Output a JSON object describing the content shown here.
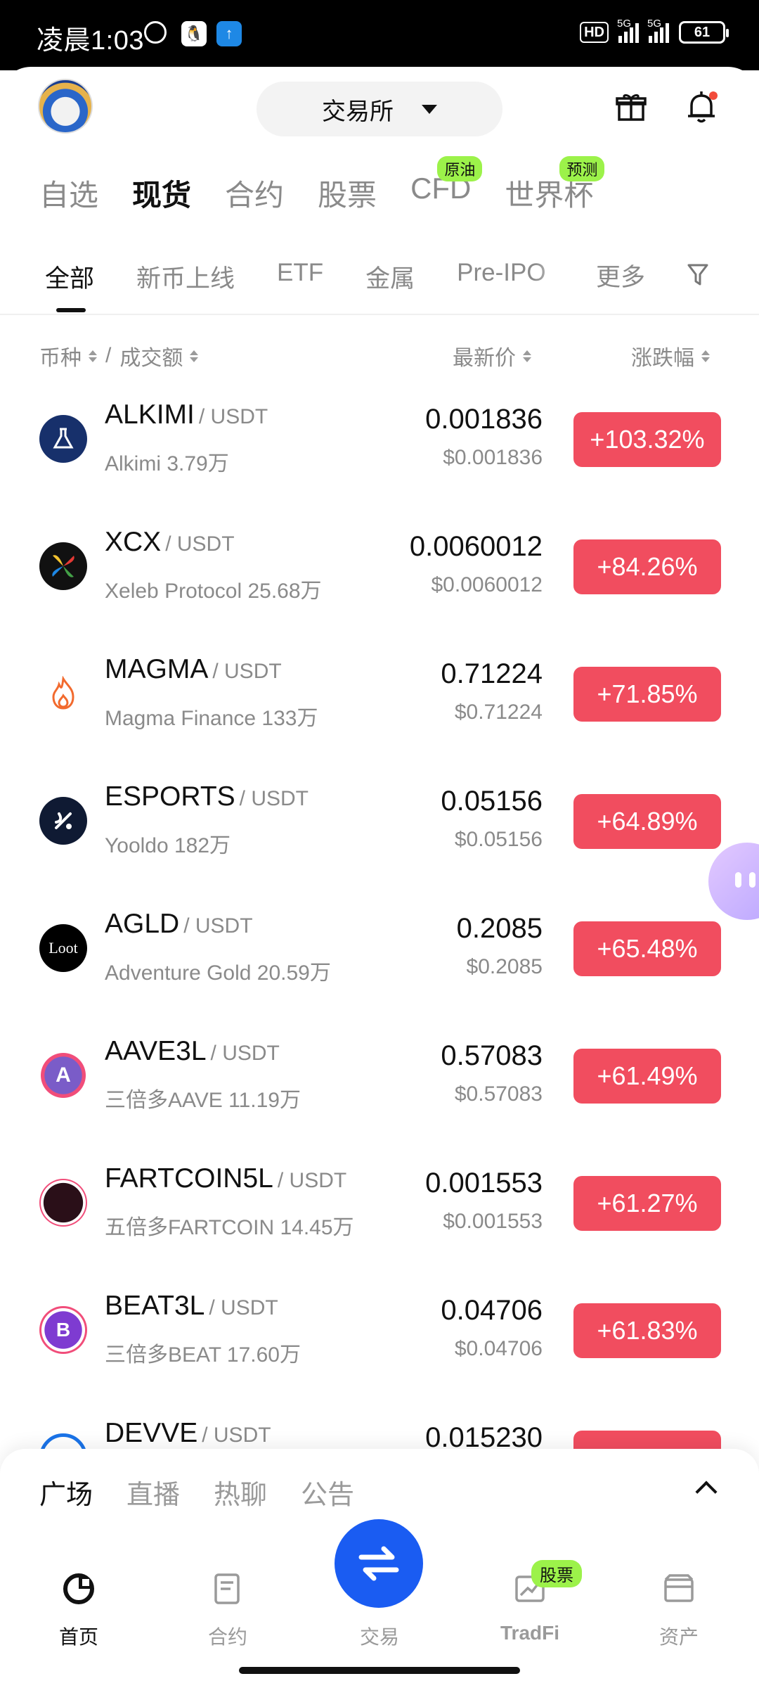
{
  "status_bar": {
    "time": "凌晨1:03",
    "battery": "61",
    "hd": "HD",
    "signal1": "5G",
    "signal2": "5G"
  },
  "header": {
    "exchange_label": "交易所"
  },
  "categories": [
    {
      "label": "自选",
      "badge": ""
    },
    {
      "label": "现货",
      "badge": "",
      "active": true
    },
    {
      "label": "合约",
      "badge": ""
    },
    {
      "label": "股票",
      "badge": ""
    },
    {
      "label": "CFD",
      "badge": "原油"
    },
    {
      "label": "世界杯",
      "badge": "预测"
    }
  ],
  "subtabs": [
    {
      "label": "全部",
      "active": true
    },
    {
      "label": "新币上线"
    },
    {
      "label": "ETF"
    },
    {
      "label": "金属"
    },
    {
      "label": "Pre-IPO"
    }
  ],
  "subtabs_more": "更多",
  "columns": {
    "coin": "币种",
    "sep": "/",
    "volume": "成交额",
    "price": "最新价",
    "change": "涨跌幅"
  },
  "rows": [
    {
      "symbol": "ALKIMI",
      "quote": "/ USDT",
      "name": "Alkimi 3.79万",
      "price": "0.001836",
      "usd": "$0.001836",
      "change": "+103.32%",
      "icon": "flask-icon",
      "icon_bg": "#17306b"
    },
    {
      "symbol": "XCX",
      "quote": "/ USDT",
      "name": "Xeleb Protocol 25.68万",
      "price": "0.0060012",
      "usd": "$0.0060012",
      "change": "+84.26%",
      "icon": "x-pinwheel-icon",
      "icon_bg": "#111111"
    },
    {
      "symbol": "MAGMA",
      "quote": "/ USDT",
      "name": "Magma Finance 133万",
      "price": "0.71224",
      "usd": "$0.71224",
      "change": "+71.85%",
      "icon": "flame-icon",
      "icon_bg": "#ffffff"
    },
    {
      "symbol": "ESPORTS",
      "quote": "/ USDT",
      "name": "Yooldo 182万",
      "price": "0.05156",
      "usd": "$0.05156",
      "change": "+64.89%",
      "icon": "yooldo-icon",
      "icon_bg": "#0f1a33"
    },
    {
      "symbol": "AGLD",
      "quote": "/ USDT",
      "name": "Adventure Gold 20.59万",
      "price": "0.2085",
      "usd": "$0.2085",
      "change": "+65.48%",
      "icon": "loot-icon",
      "icon_bg": "#000000",
      "icon_text": "Loot"
    },
    {
      "symbol": "AAVE3L",
      "quote": "/ USDT",
      "name": "三倍多AAVE 11.19万",
      "price": "0.57083",
      "usd": "$0.57083",
      "change": "+61.49%",
      "icon": "aave3l-icon",
      "icon_bg": "#7a5cc8",
      "icon_text": "A"
    },
    {
      "symbol": "FARTCOIN5L",
      "quote": "/ USDT",
      "name": "五倍多FARTCOIN 14.45万",
      "price": "0.001553",
      "usd": "$0.001553",
      "change": "+61.27%",
      "icon": "fartcoin5l-icon",
      "icon_bg": "#2a0f18"
    },
    {
      "symbol": "BEAT3L",
      "quote": "/ USDT",
      "name": "三倍多BEAT 17.60万",
      "price": "0.04706",
      "usd": "$0.04706",
      "change": "+61.83%",
      "icon": "beat3l-icon",
      "icon_bg": "#7e3bd1",
      "icon_text": "B"
    },
    {
      "symbol": "DEVVE",
      "quote": "/ USDT",
      "name": "",
      "price": "0.015230",
      "usd": "",
      "change": "",
      "icon": "devve-icon",
      "icon_bg": "#1a73e8"
    }
  ],
  "feed_tabs": [
    {
      "label": "广场",
      "active": true
    },
    {
      "label": "直播"
    },
    {
      "label": "热聊"
    },
    {
      "label": "公告"
    }
  ],
  "nav": {
    "home": "首页",
    "contract": "合约",
    "trade": "交易",
    "tradfi": "TradFi",
    "tradfi_badge": "股票",
    "assets": "资产"
  },
  "colors": {
    "up": "#f14d5f",
    "accent": "#1a5cf2",
    "badge": "#9cf24a"
  }
}
